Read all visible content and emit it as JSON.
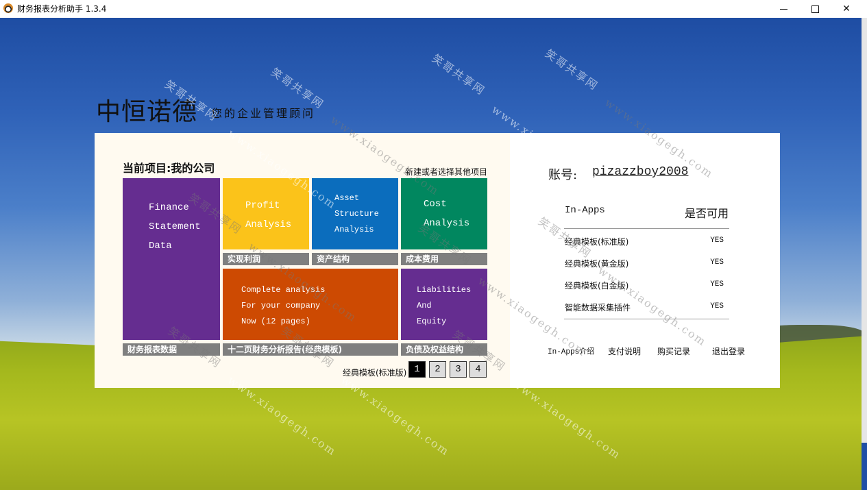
{
  "window": {
    "title": "财务报表分析助手 1.3.4",
    "icon": "dog-app-icon",
    "controls": {
      "minimize": "minimize-icon",
      "maximize": "maximize-icon",
      "close": "close-icon"
    }
  },
  "brand": {
    "name": "中恒诺德",
    "slogan": "您的企业管理顾问"
  },
  "project": {
    "title": "当前项目:我的公司",
    "new_or_select_link": "新建或者选择其他项目"
  },
  "tiles": [
    {
      "id": "finance",
      "lines": [
        "Finance",
        "Statement",
        "Data"
      ],
      "label": "财务报表数据",
      "color": "#652d90"
    },
    {
      "id": "profit",
      "lines": [
        "Profit",
        "Analysis"
      ],
      "label": "实现利润",
      "color": "#fbc31a"
    },
    {
      "id": "asset",
      "lines": [
        "Asset",
        "Structure",
        "Analysis"
      ],
      "label": "资产结构",
      "color": "#0b6dbd"
    },
    {
      "id": "cost",
      "lines": [
        "Cost",
        "Analysis"
      ],
      "label": "成本费用",
      "color": "#01875f"
    },
    {
      "id": "complete",
      "lines": [
        "Complete analysis",
        "For your company",
        "Now (12 pages)"
      ],
      "label": "十二页财务分析报告(经典模板)",
      "color": "#cd4a02"
    },
    {
      "id": "liabilities",
      "lines": [
        "Liabilities",
        "And",
        "Equity"
      ],
      "label": "负债及权益结构",
      "color": "#652d90"
    }
  ],
  "pagination": {
    "template_name": "经典模板(标准版)",
    "pages": [
      "1",
      "2",
      "3",
      "4"
    ],
    "active_page": "1"
  },
  "account": {
    "label": "账号:",
    "username": "pizazzboy2008"
  },
  "inapps": {
    "header_name": "In-Apps",
    "header_status": "是否可用",
    "items": [
      {
        "name": "经典模板(标准版)",
        "status": "YES"
      },
      {
        "name": "经典模板(黄金版)",
        "status": "YES"
      },
      {
        "name": "经典模板(白金版)",
        "status": "YES"
      },
      {
        "name": "智能数据采集插件",
        "status": "YES"
      }
    ]
  },
  "footer_links": [
    "In-Apps介绍",
    "支付说明",
    "购买记录",
    "退出登录"
  ],
  "watermark": {
    "text1": "笑哥共享网",
    "text2": "www.xiaogegh.com"
  }
}
